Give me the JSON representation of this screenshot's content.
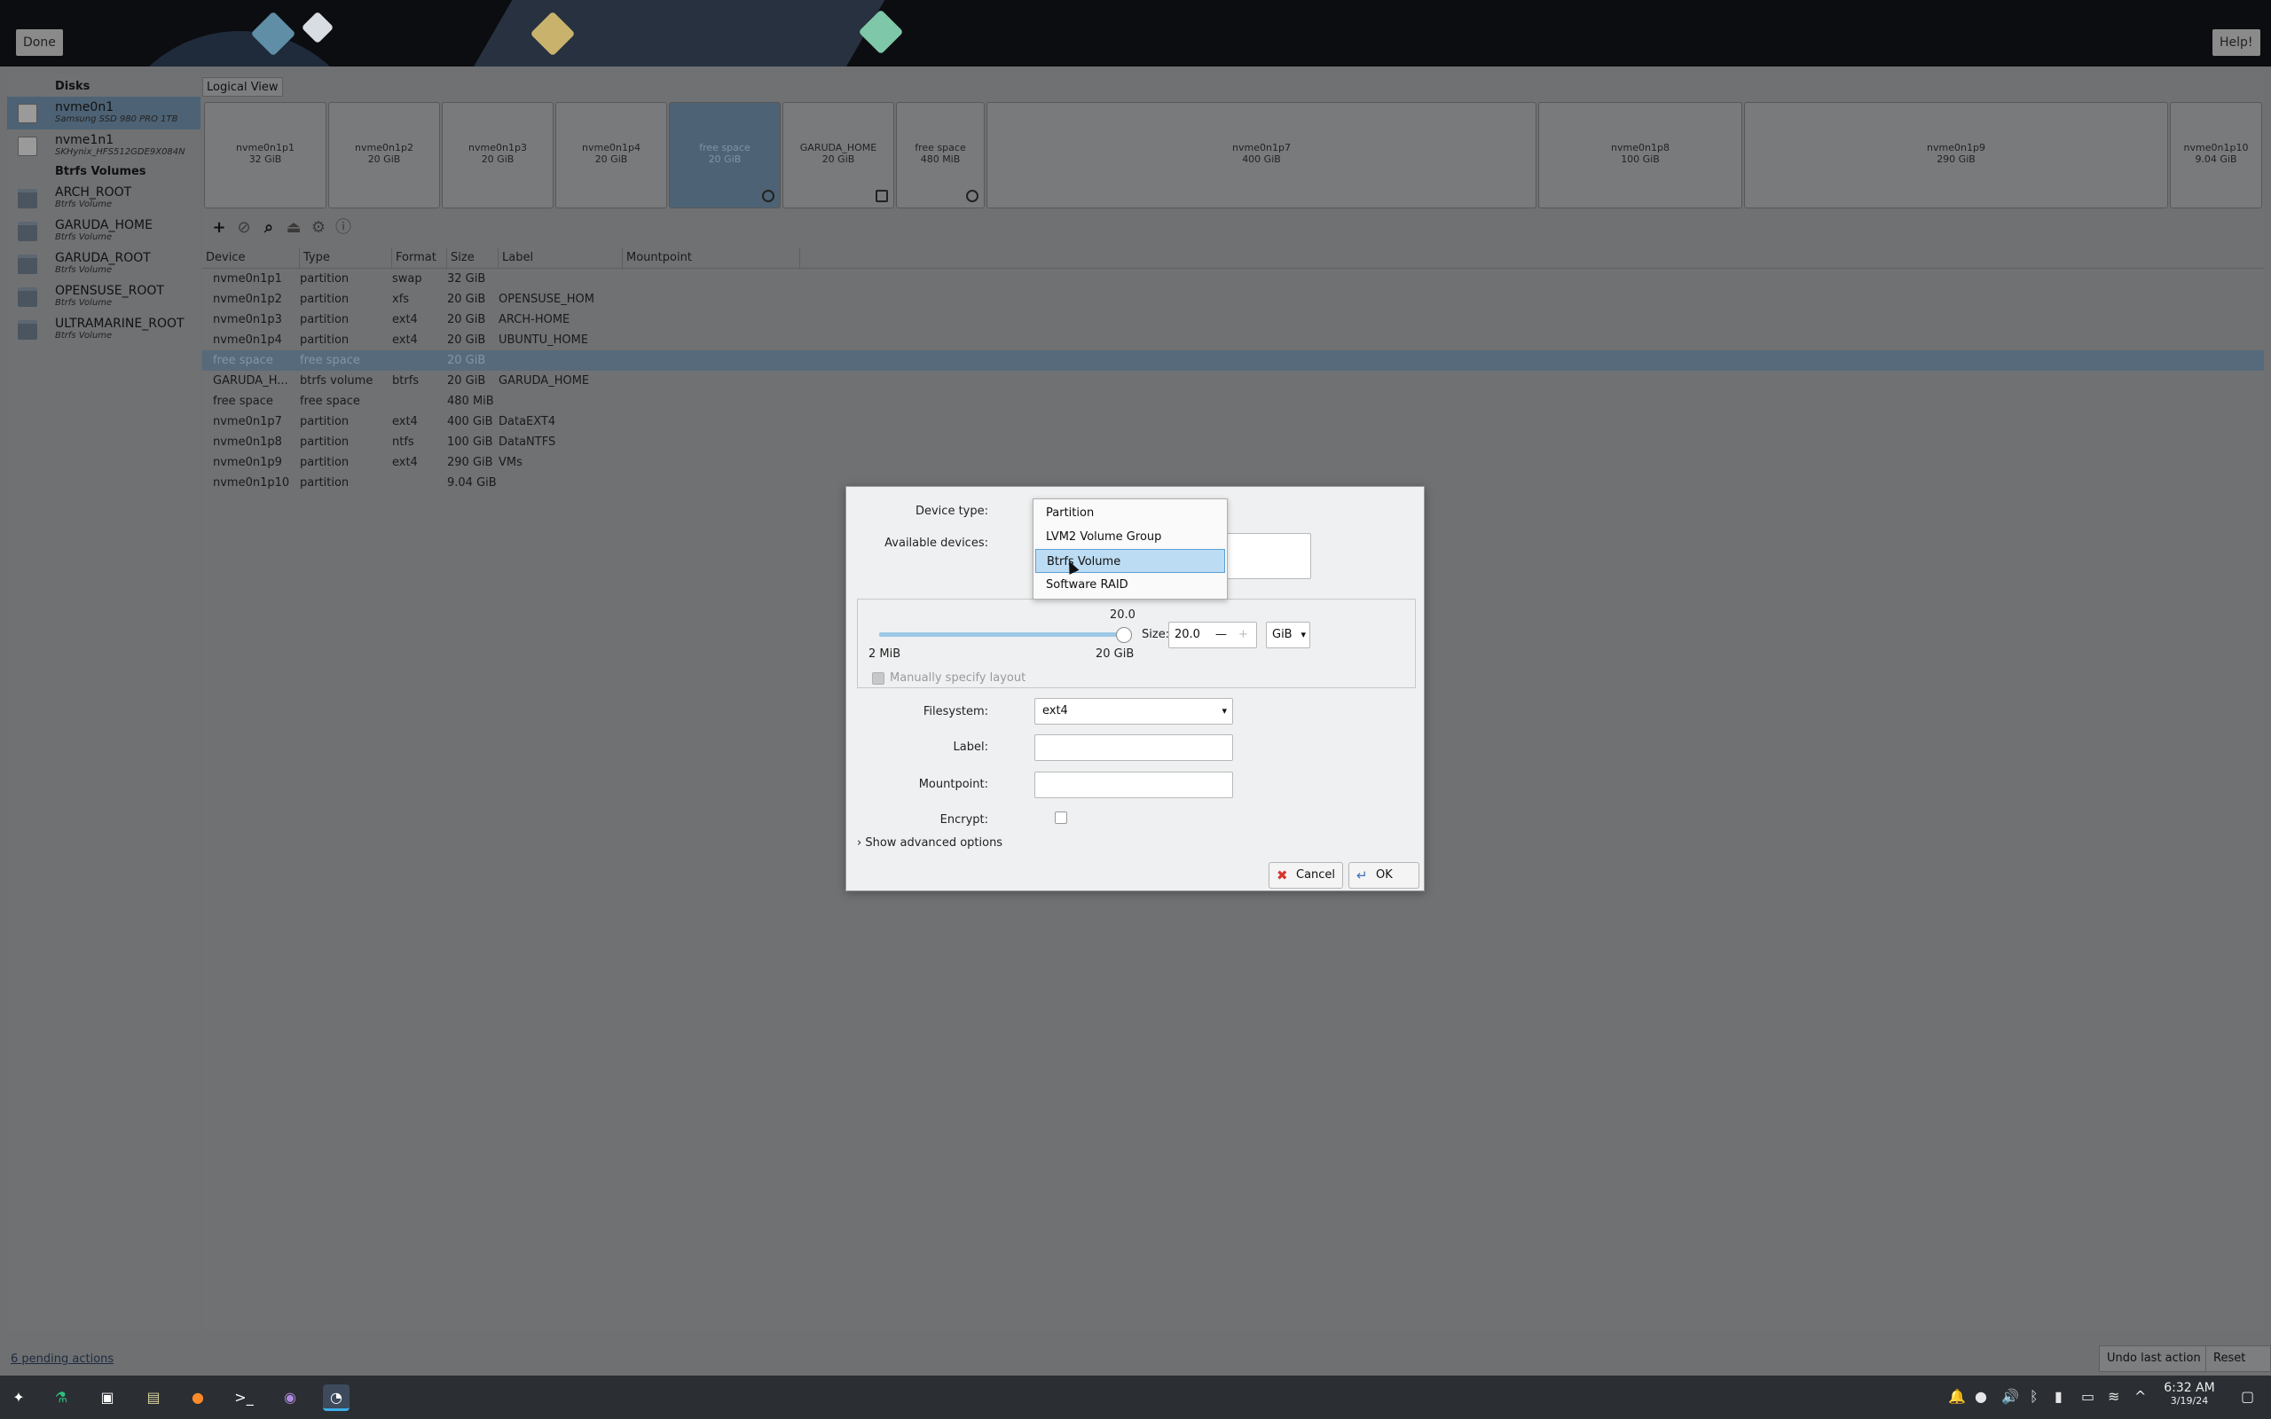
{
  "topbar": {
    "done": "Done",
    "help": "Help!"
  },
  "sidebar": {
    "disks_header": "Disks",
    "disks": [
      {
        "name": "nvme0n1",
        "desc": "Samsung SSD 980 PRO 1TB"
      },
      {
        "name": "nvme1n1",
        "desc": "SKHynix_HFS512GDE9X084N"
      }
    ],
    "btrfs_header": "Btrfs Volumes",
    "volumes": [
      {
        "name": "ARCH_ROOT",
        "desc": "Btrfs Volume"
      },
      {
        "name": "GARUDA_HOME",
        "desc": "Btrfs Volume"
      },
      {
        "name": "GARUDA_ROOT",
        "desc": "Btrfs Volume"
      },
      {
        "name": "OPENSUSE_ROOT",
        "desc": "Btrfs Volume"
      },
      {
        "name": "ULTRAMARINE_ROOT",
        "desc": "Btrfs Volume"
      }
    ]
  },
  "view_tab": "Logical View",
  "partitions": [
    {
      "name": "nvme0n1p1",
      "size": "32 GiB"
    },
    {
      "name": "nvme0n1p2",
      "size": "20 GiB"
    },
    {
      "name": "nvme0n1p3",
      "size": "20 GiB"
    },
    {
      "name": "nvme0n1p4",
      "size": "20 GiB"
    },
    {
      "name": "free space",
      "size": "20 GiB"
    },
    {
      "name": "GARUDA_HOME",
      "size": "20 GiB"
    },
    {
      "name": "free space",
      "size": "480 MiB"
    },
    {
      "name": "nvme0n1p7",
      "size": "400 GiB"
    },
    {
      "name": "nvme0n1p8",
      "size": "100 GiB"
    },
    {
      "name": "nvme0n1p9",
      "size": "290 GiB"
    },
    {
      "name": "nvme0n1p10",
      "size": "9.04 GiB"
    }
  ],
  "table": {
    "headers": [
      "Device",
      "Type",
      "Format",
      "Size",
      "Label",
      "Mountpoint"
    ],
    "rows": [
      [
        "nvme0n1p1",
        "partition",
        "swap",
        "32 GiB",
        "",
        ""
      ],
      [
        "nvme0n1p2",
        "partition",
        "xfs",
        "20 GiB",
        "OPENSUSE_HOM",
        ""
      ],
      [
        "nvme0n1p3",
        "partition",
        "ext4",
        "20 GiB",
        "ARCH-HOME",
        ""
      ],
      [
        "nvme0n1p4",
        "partition",
        "ext4",
        "20 GiB",
        "UBUNTU_HOME",
        ""
      ],
      [
        "free space",
        "free space",
        "",
        "20 GiB",
        "",
        ""
      ],
      [
        "GARUDA_H...",
        "btrfs volume",
        "btrfs",
        "20 GiB",
        "GARUDA_HOME",
        ""
      ],
      [
        "free space",
        "free space",
        "",
        "480 MiB",
        "",
        ""
      ],
      [
        "nvme0n1p7",
        "partition",
        "ext4",
        "400 GiB",
        "DataEXT4",
        ""
      ],
      [
        "nvme0n1p8",
        "partition",
        "ntfs",
        "100 GiB",
        "DataNTFS",
        ""
      ],
      [
        "nvme0n1p9",
        "partition",
        "ext4",
        "290 GiB",
        "VMs",
        ""
      ],
      [
        "nvme0n1p10",
        "partition",
        "",
        "9.04 GiB",
        "",
        ""
      ]
    ]
  },
  "dialog": {
    "device_type_label": "Device type:",
    "available_devices_label": "Available devices:",
    "slider_value": "20.0",
    "slider_fraction": 1.0,
    "min_label": "2 MiB",
    "max_label": "20 GiB",
    "size_label": "Size:",
    "size_value": "20.0",
    "size_unit": "GiB",
    "manual_layout": "Manually specify layout",
    "filesystem_label": "Filesystem:",
    "filesystem_value": "ext4",
    "label_label": "Label:",
    "label_value": "",
    "mountpoint_label": "Mountpoint:",
    "mountpoint_value": "",
    "encrypt_label": "Encrypt:",
    "advanced": "Show advanced options",
    "cancel": "Cancel",
    "ok": "OK",
    "device_type_options": [
      "Partition",
      "LVM2 Volume Group",
      "Btrfs Volume",
      "Software RAID"
    ],
    "selected_option": "Btrfs Volume"
  },
  "status": {
    "pending": "6 pending actions",
    "undo": "Undo last action",
    "reset": "Reset All"
  },
  "clock": {
    "time": "6:32 AM",
    "date": "3/19/24"
  },
  "colors": {
    "accent": "#3daee9",
    "selection": "#4d6274",
    "popup_highlight": "#bcdcf3"
  }
}
